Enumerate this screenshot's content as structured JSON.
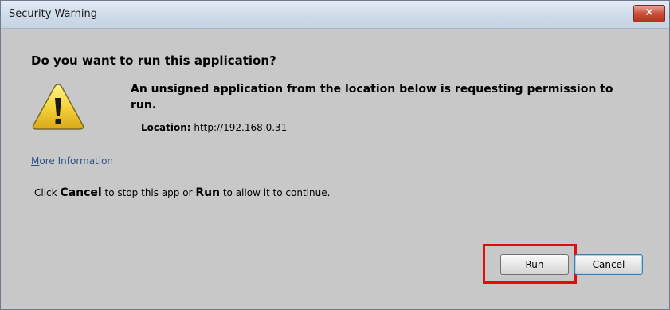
{
  "window": {
    "title": "Security Warning",
    "close_glyph": "✕"
  },
  "dialog": {
    "heading": "Do you want to run this application?",
    "message_line1": "An unsigned application from the location below is requesting permission to",
    "message_line2": "run.",
    "location_label": "Location:",
    "location_value": "http://192.168.0.31",
    "more_info_first": "M",
    "more_info_rest": "ore Information",
    "instruction": {
      "part1": "Click ",
      "cancel_word": "Cancel",
      "part2": " to stop this app or ",
      "run_word": "Run",
      "part3": " to allow it to continue."
    }
  },
  "buttons": {
    "run_mnemonic": "R",
    "run_rest": "un",
    "cancel": "Cancel"
  },
  "icons": {
    "warning": "warning-triangle-icon",
    "close": "close-icon"
  },
  "colors": {
    "highlight": "#e30b0b",
    "warning_yellow": "#f5d43a",
    "link": "#2e4f8a"
  }
}
